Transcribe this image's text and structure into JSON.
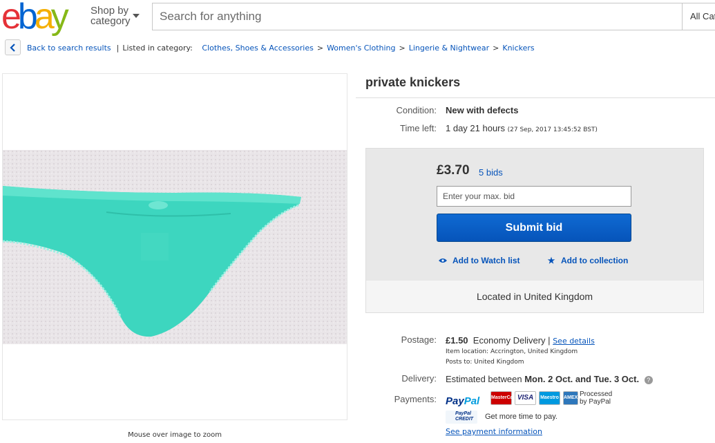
{
  "header": {
    "logo_letters": [
      {
        "char": "e",
        "color": "#e53238"
      },
      {
        "char": "b",
        "color": "#0064d2"
      },
      {
        "char": "a",
        "color": "#f5af02"
      },
      {
        "char": "y",
        "color": "#86b817"
      }
    ],
    "shop_by_line1": "Shop by",
    "shop_by_line2": "category",
    "search_placeholder": "Search for anything",
    "category_select": "All Cat"
  },
  "breadcrumb": {
    "back_label": "Back to search results",
    "listed_label": "Listed in category:",
    "items": [
      "Clothes, Shoes & Accessories",
      "Women's Clothing",
      "Lingerie & Nightwear",
      "Knickers"
    ],
    "sep": ">"
  },
  "image": {
    "zoom_note": "Mouse over image to zoom"
  },
  "item": {
    "title": "private knickers",
    "condition_label": "Condition:",
    "condition_value": "New with defects",
    "time_left_label": "Time left:",
    "time_left_value": "1 day 21 hours",
    "time_left_detail": "(27 Sep, 2017   13:45:52 BST)"
  },
  "bid": {
    "price": "£3.70",
    "bids": "5 bids",
    "input_placeholder": "Enter your max. bid",
    "submit_label": "Submit bid",
    "watch_label": "Add to Watch list",
    "collection_label": "Add to collection",
    "location": "Located in United Kingdom"
  },
  "postage": {
    "label": "Postage:",
    "price": "£1.50",
    "method": "Economy Delivery",
    "pipe": "|",
    "details_link": "See details",
    "item_location": "Item location:  Accrington, United Kingdom",
    "posts_to": "Posts to:  United Kingdom"
  },
  "delivery": {
    "label": "Delivery:",
    "prefix": "Estimated between",
    "dates": "Mon. 2 Oct. and Tue. 3 Oct.",
    "help": "?"
  },
  "payments": {
    "label": "Payments:",
    "paypal_pay": "Pay",
    "paypal_pal": "Pal",
    "cards": [
      {
        "name": "MasterCard",
        "color": "#cc0000"
      },
      {
        "name": "VISA",
        "color": "#1a1f71"
      },
      {
        "name": "Maestro",
        "color": "#0099df"
      },
      {
        "name": "AMEX",
        "color": "#2e77bb"
      }
    ],
    "processed_line1": "Processed",
    "processed_line2": "by PayPal",
    "credit_line1": "PayPal",
    "credit_line2": "CREDIT",
    "credit_text": "Get more time to pay.",
    "info_link": "See payment information"
  }
}
